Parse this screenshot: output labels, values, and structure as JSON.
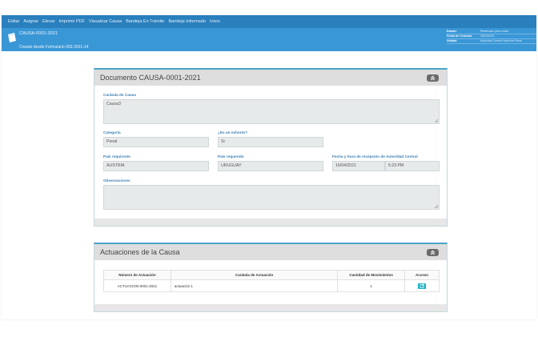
{
  "menu": [
    "Editar",
    "Asignar",
    "Elevar",
    "Imprimir PDF",
    "Visualizar Causa",
    "Bandeja En Trámite",
    "Bandeja Informado",
    "Inicio"
  ],
  "header": {
    "case_code": "CAUSA-0001-2021",
    "subtitle": "Creado desde Formulario 003-2021-14",
    "meta": [
      {
        "key": "Estado:",
        "value": "Reservado para enviar"
      },
      {
        "key": "Fecha de Creación:",
        "value": "16/04/2021"
      },
      {
        "key": "Unidad:",
        "value": "Autoridad Central Nacional Penal"
      }
    ]
  },
  "document": {
    "title": "Documento CAUSA-0001-2021",
    "fields": {
      "caratula_label": "Carátula de Causa",
      "caratula_value": "Causa3",
      "categoria_label": "Categoría",
      "categoria_value": "Penal",
      "exhorto_label": "¿Es un exhorto?",
      "exhorto_value": "Si",
      "pais_req_label": "País requirente",
      "pais_req_value": "AUSTRIA",
      "pais_rdo_label": "País requerido",
      "pais_rdo_value": "URUGUAY",
      "fecha_label": "Fecha y hora de recepción de Autoridad Central",
      "fecha_date": "16/04/2021",
      "fecha_time": "5:23 PM",
      "obs_label": "Observaciones",
      "obs_value": ""
    }
  },
  "actuaciones": {
    "title": "Actuaciones de la Causa",
    "columns": [
      "Número de Actuación",
      "Carátula de Actuación",
      "Cantidad de Movimientos",
      "Acceso"
    ],
    "rows": [
      {
        "numero": "ACTUACION-0001-2021",
        "caratula": "actuación 1",
        "cantidad": "1"
      }
    ]
  },
  "colors": {
    "menubar": "#2a7fbd",
    "header": "#3a97d6",
    "label": "#3b7eb0",
    "access_button": "#17b0c5"
  },
  "icons": {
    "collapse": "double-chevron-up-icon",
    "access": "edit-external-icon",
    "logo": "document-icon"
  }
}
